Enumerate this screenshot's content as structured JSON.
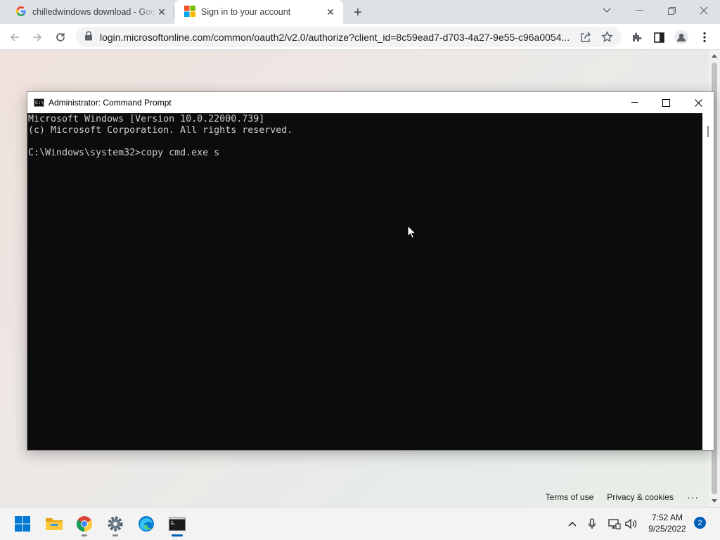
{
  "browser": {
    "tabs": [
      {
        "title": "chilledwindows download - Goog",
        "favicon": "google-favicon",
        "active": false
      },
      {
        "title": "Sign in to your account",
        "favicon": "microsoft-favicon",
        "active": true
      }
    ],
    "new_tab_icon": "plus-icon",
    "window_controls": [
      "chevron-down-icon",
      "minimize-icon",
      "restore-icon",
      "close-icon"
    ],
    "url": "login.microsoftonline.com/common/oauth2/v2.0/authorize?client_id=8c59ead7-d703-4a27-9e55-c96a0054...",
    "toolbar_icons": [
      "back-icon",
      "forward-icon",
      "reload-icon",
      "lock-icon",
      "share-icon",
      "star-icon",
      "extensions-icon",
      "side-panel-icon",
      "profile-icon",
      "menu-icon"
    ]
  },
  "page": {
    "footer": {
      "terms": "Terms of use",
      "privacy": "Privacy & cookies",
      "more": "···"
    }
  },
  "cmd": {
    "title": "Administrator: Command Prompt",
    "icon_text": "C:\\_",
    "lines": [
      "Microsoft Windows [Version 10.0.22000.739]",
      "(c) Microsoft Corporation. All rights reserved.",
      "",
      "C:\\Windows\\system32>copy cmd.exe s"
    ]
  },
  "taskbar": {
    "apps": [
      "start-icon",
      "file-explorer-icon",
      "chrome-icon",
      "settings-icon",
      "edge-icon",
      "terminal-icon"
    ],
    "active_app": "terminal-icon",
    "clock_time": "7:52 AM",
    "clock_date": "9/25/2022",
    "notifications": "2"
  },
  "colors": {
    "accent": "#005fb8",
    "cmd_background": "#0c0c0c",
    "cmd_text": "#cccccc"
  }
}
